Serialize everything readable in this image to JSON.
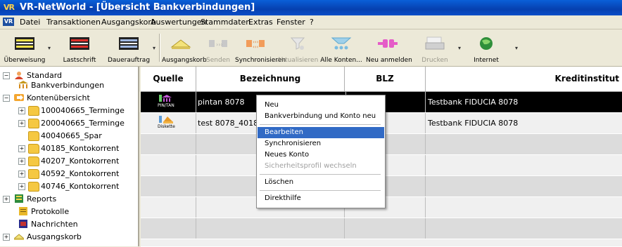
{
  "window": {
    "title": "VR-NetWorld - [Übersicht Bankverbindungen]",
    "logo": "VR"
  },
  "menubar": {
    "logo": "VR",
    "items": [
      "Datei",
      "Transaktionen",
      "Ausgangskorb",
      "Auswertungen",
      "Stammdaten",
      "Extras",
      "Fenster",
      "?"
    ]
  },
  "toolbar": {
    "buttons": [
      {
        "label": "Überweisung"
      },
      {
        "label": "Lastschrift"
      },
      {
        "label": "Dauerauftrag"
      },
      {
        "label": "Ausgangskorb"
      },
      {
        "label": "Senden"
      },
      {
        "label": "Synchronisieren"
      },
      {
        "label": "Aktualisieren"
      },
      {
        "label": "Alle Konten..."
      },
      {
        "label": "Neu anmelden"
      },
      {
        "label": "Drucken"
      },
      {
        "label": "Internet"
      }
    ]
  },
  "tree": {
    "items": [
      {
        "label": "Standard"
      },
      {
        "label": "Bankverbindungen"
      },
      {
        "label": "Kontenübersicht"
      },
      {
        "label": "100040665_Terminge"
      },
      {
        "label": "200040665_Terminge"
      },
      {
        "label": "40040665_Spar"
      },
      {
        "label": "40185_Kontokorrent"
      },
      {
        "label": "40207_Kontokorrent"
      },
      {
        "label": "40592_Kontokorrent"
      },
      {
        "label": "40746_Kontokorrent"
      },
      {
        "label": "Reports"
      },
      {
        "label": "Protokolle"
      },
      {
        "label": "Nachrichten"
      },
      {
        "label": "Ausgangskorb"
      }
    ]
  },
  "grid": {
    "columns": [
      "Quelle",
      "Bezeichnung",
      "BLZ",
      "Kreditinstitut"
    ],
    "rows": [
      {
        "quelle": "PIN/TAN",
        "bezeichnung": "pintan 8078",
        "blz": "",
        "kreditinstitut": "Testbank FIDUCIA 8078"
      },
      {
        "quelle": "Diskette",
        "bezeichnung": "test 8078_401850",
        "blz": "",
        "kreditinstitut": "Testbank FIDUCIA 8078"
      }
    ]
  },
  "context_menu": {
    "items": [
      {
        "label": "Neu",
        "state": "normal"
      },
      {
        "label": "Bankverbindung und Konto neu",
        "state": "normal"
      },
      {
        "label": "Bearbeiten",
        "state": "highlighted"
      },
      {
        "label": "Synchronisieren",
        "state": "normal"
      },
      {
        "label": "Neues Konto",
        "state": "normal"
      },
      {
        "label": "Sicherheitsprofil wechseln",
        "state": "disabled"
      },
      {
        "label": "Löschen",
        "state": "normal"
      },
      {
        "label": "Direkthilfe",
        "state": "normal"
      }
    ]
  },
  "colors": {
    "titlebar": "#0a4ec8",
    "selection": "#000000",
    "menu_highlight": "#316ac5"
  }
}
